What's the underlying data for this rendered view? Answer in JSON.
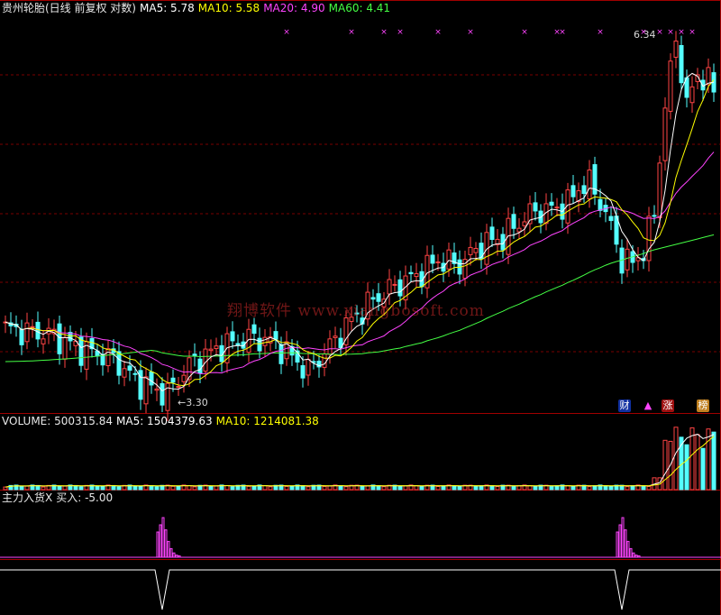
{
  "colors": {
    "up": "#ff4444",
    "down": "#54ffff",
    "ma5": "#ffffff",
    "ma10": "#ffff00",
    "ma20": "#ff44ff",
    "ma60": "#44ff44",
    "grid": "#7a0000",
    "marker": "#ff44ff"
  },
  "main_header": {
    "stock": "贵州轮胎(日线 前复权 对数)",
    "ma5": "MA5: 5.78",
    "ma10": "MA10: 5.58",
    "ma20": "MA20: 4.90",
    "ma60": "MA60: 4.41"
  },
  "volume_header": {
    "volume": "VOLUME: 500315.84",
    "ma5": "MA5: 1504379.63",
    "ma10": "MA10: 1214081.38"
  },
  "indicator_header": {
    "name": "主力入货X",
    "buy": "买入: -5.00"
  },
  "annotations": {
    "high_label": "6.34",
    "low_label": "←3.30",
    "watermark": "翔博软件 www.xiangbosoft.com",
    "badge_cai": "财",
    "badge_up": "▲",
    "badge_zhang": "涨",
    "badge_bang": "榜"
  },
  "chart_data": [
    {
      "type": "candlestick",
      "title": "贵州轮胎(日线 前复权 对数)",
      "scale": "log",
      "ylim": [
        3.2,
        6.5
      ],
      "grid": true,
      "annotations": [
        {
          "label": "6.34",
          "kind": "period-high"
        },
        {
          "label": "3.30",
          "kind": "period-low"
        }
      ],
      "series": [
        {
          "name": "MA5",
          "last": 5.78
        },
        {
          "name": "MA10",
          "last": 5.58
        },
        {
          "name": "MA20",
          "last": 4.9
        },
        {
          "name": "MA60",
          "last": 4.41
        }
      ],
      "close_path": [
        [
          0,
          3.72
        ],
        [
          8,
          3.68
        ],
        [
          14,
          3.58
        ],
        [
          20,
          3.52
        ],
        [
          24,
          3.38
        ],
        [
          28,
          3.32
        ],
        [
          30,
          3.3
        ],
        [
          34,
          3.48
        ],
        [
          40,
          3.6
        ],
        [
          46,
          3.66
        ],
        [
          50,
          3.62
        ],
        [
          54,
          3.5
        ],
        [
          56,
          3.44
        ],
        [
          60,
          3.6
        ],
        [
          64,
          3.78
        ],
        [
          68,
          3.92
        ],
        [
          72,
          4.02
        ],
        [
          76,
          4.1
        ],
        [
          80,
          4.22
        ],
        [
          84,
          4.18
        ],
        [
          88,
          4.34
        ],
        [
          92,
          4.4
        ],
        [
          94,
          4.48
        ],
        [
          96,
          4.56
        ],
        [
          98,
          4.62
        ],
        [
          100,
          4.62
        ],
        [
          104,
          4.68
        ],
        [
          106,
          4.82
        ],
        [
          108,
          4.86
        ],
        [
          110,
          4.7
        ],
        [
          112,
          4.48
        ],
        [
          114,
          4.22
        ],
        [
          116,
          4.2
        ],
        [
          118,
          4.3
        ],
        [
          120,
          4.6
        ],
        [
          122,
          5.6
        ],
        [
          124,
          6.34
        ],
        [
          126,
          5.6
        ],
        [
          128,
          5.95
        ],
        [
          130,
          5.85
        ],
        [
          131,
          5.78
        ]
      ]
    },
    {
      "type": "bar",
      "title": "VOLUME",
      "series": [
        {
          "name": "VOLUME",
          "last": 500315.84
        },
        {
          "name": "MA5",
          "last": 1504379.63
        },
        {
          "name": "MA10",
          "last": 1214081.38
        }
      ]
    },
    {
      "type": "bar",
      "title": "主力入货X",
      "series": [
        {
          "name": "买入",
          "last": -5.0
        }
      ],
      "signal_days": [
        29,
        114
      ]
    }
  ]
}
